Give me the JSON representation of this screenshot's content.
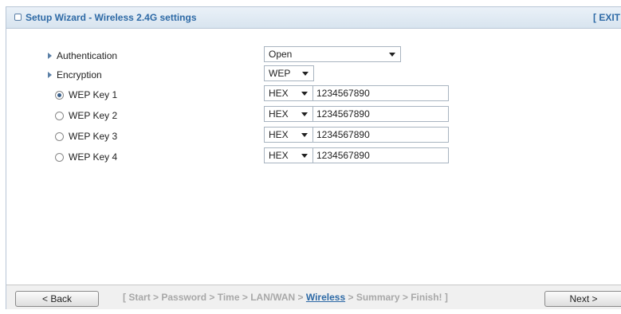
{
  "header": {
    "title": "Setup Wizard - Wireless 2.4G settings",
    "exit_label": "[ EXIT"
  },
  "form": {
    "authentication": {
      "label": "Authentication",
      "value": "Open"
    },
    "encryption": {
      "label": "Encryption",
      "value": "WEP"
    },
    "keys": [
      {
        "label": "WEP Key  1",
        "selected": true,
        "format": "HEX",
        "value": "1234567890"
      },
      {
        "label": "WEP Key  2",
        "selected": false,
        "format": "HEX",
        "value": "1234567890"
      },
      {
        "label": "WEP Key  3",
        "selected": false,
        "format": "HEX",
        "value": "1234567890"
      },
      {
        "label": "WEP Key  4",
        "selected": false,
        "format": "HEX",
        "value": "1234567890"
      }
    ]
  },
  "footer": {
    "back_label": "< Back",
    "next_label": "Next >",
    "steps": {
      "open": "[",
      "before": "Start > Password > Time > LAN/WAN >",
      "current": "Wireless",
      "after": "> Summary > Finish!",
      "close": "]"
    }
  }
}
